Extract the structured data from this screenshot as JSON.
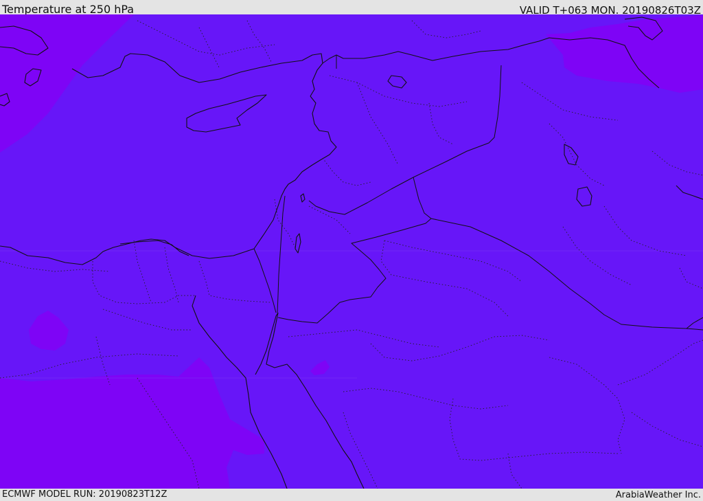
{
  "header": {
    "title": "Temperature at 250 hPa",
    "valid": "VALID T+063 MON. 20190826T03Z"
  },
  "footer": {
    "model_run": "ECMWF MODEL RUN: 20190823T12Z",
    "credit": "ArabiaWeather Inc."
  },
  "colors": {
    "field_main": "#6716f8",
    "field_warm": "#7e04f6",
    "coast_border": "#111111",
    "frame": "#e4e4e4"
  }
}
